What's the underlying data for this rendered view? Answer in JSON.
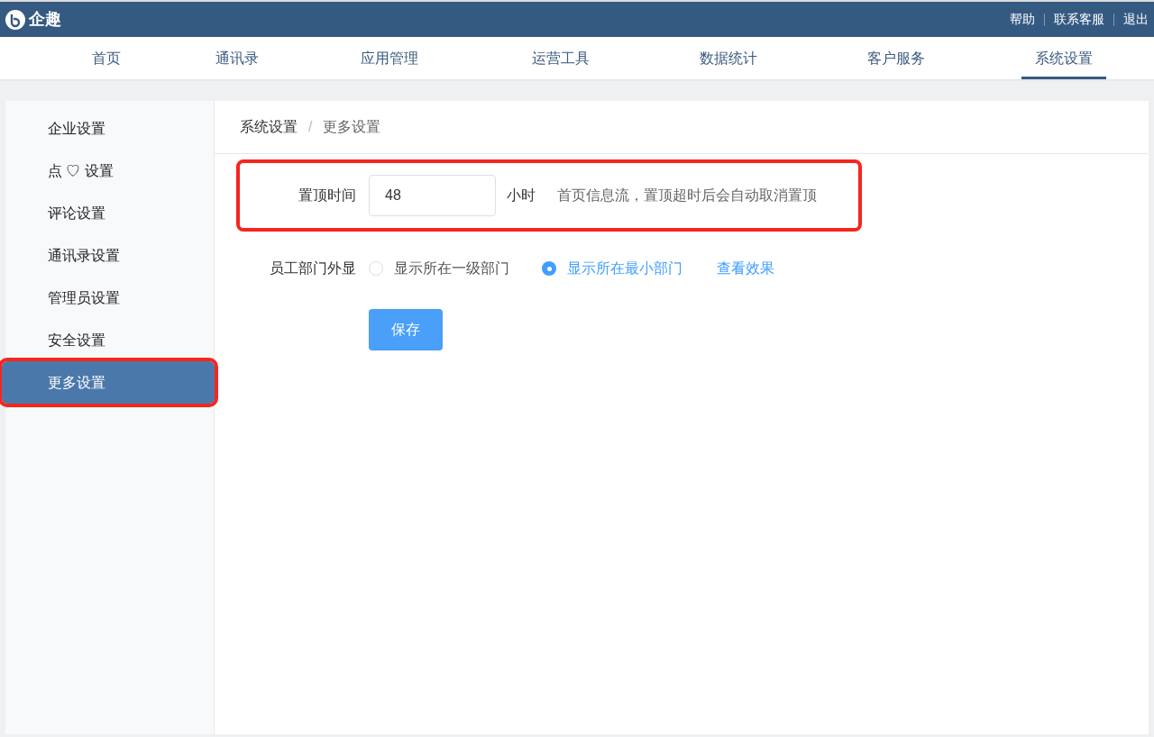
{
  "header": {
    "logo": "企趣",
    "links": [
      "帮助",
      "联系客服",
      "退出"
    ]
  },
  "nav": [
    {
      "label": "首页",
      "selected": false
    },
    {
      "label": "通讯录",
      "selected": false
    },
    {
      "label": "应用管理",
      "selected": false
    },
    {
      "label": "运营工具",
      "selected": false
    },
    {
      "label": "数据统计",
      "selected": false
    },
    {
      "label": "客户服务",
      "selected": false
    },
    {
      "label": "系统设置",
      "selected": true
    }
  ],
  "sidebar": [
    {
      "label": "企业设置",
      "selected": false,
      "highlighted": false
    },
    {
      "label": "点 ♡ 设置",
      "selected": false,
      "highlighted": false
    },
    {
      "label": "评论设置",
      "selected": false,
      "highlighted": false
    },
    {
      "label": "通讯录设置",
      "selected": false,
      "highlighted": false
    },
    {
      "label": "管理员设置",
      "selected": false,
      "highlighted": false
    },
    {
      "label": "安全设置",
      "selected": false,
      "highlighted": false
    },
    {
      "label": "更多设置",
      "selected": true,
      "highlighted": true
    }
  ],
  "breadcrumb": [
    "系统设置",
    "更多设置"
  ],
  "breadcrumb_separator": "/",
  "pin_time": {
    "label": "置顶时间",
    "value": "48",
    "unit": "小时",
    "hint": "首页信息流，置顶超时后会自动取消置顶",
    "highlighted": true
  },
  "department_display": {
    "label": "员工部门外显",
    "options": [
      {
        "label": "显示所在一级部门",
        "selected": false
      },
      {
        "label": "显示所在最小部门",
        "selected": true
      }
    ],
    "link": "查看效果"
  },
  "save_button": "保存"
}
